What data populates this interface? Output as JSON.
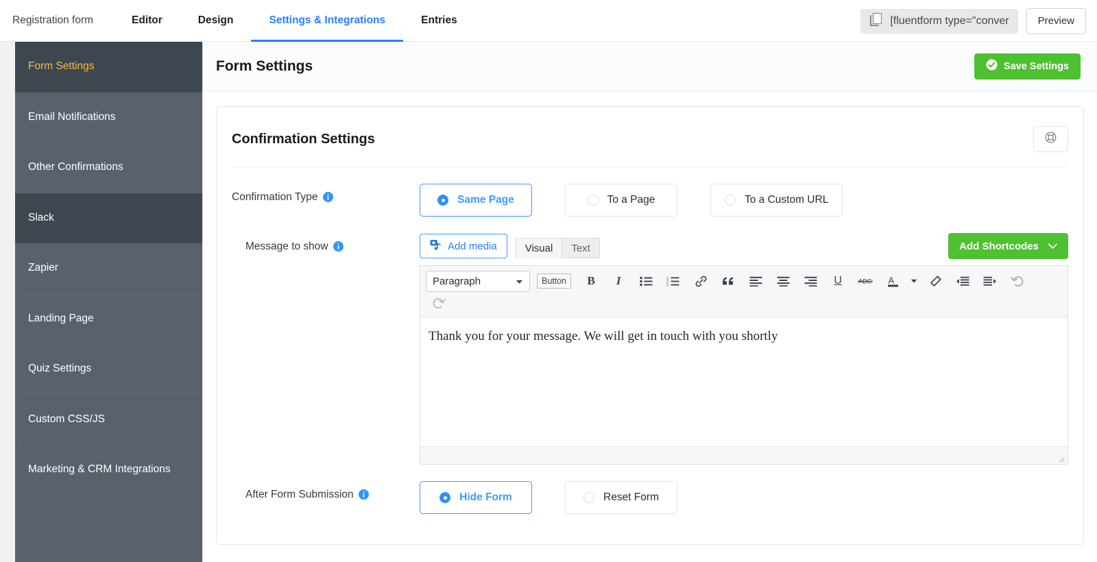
{
  "topbar": {
    "form_name": "Registration form",
    "tabs": [
      {
        "label": "Editor",
        "active": false
      },
      {
        "label": "Design",
        "active": false
      },
      {
        "label": "Settings & Integrations",
        "active": true
      },
      {
        "label": "Entries",
        "active": false
      }
    ],
    "shortcode": "[fluentform type=\"conver",
    "copy_icon": "copy-icon",
    "preview_label": "Preview"
  },
  "sidebar": {
    "items": [
      {
        "label": "Form Settings",
        "state": "active"
      },
      {
        "label": "Email Notifications",
        "state": "normal"
      },
      {
        "label": "Other Confirmations",
        "state": "normal"
      },
      {
        "label": "Slack",
        "state": "hover"
      },
      {
        "label": "Zapier",
        "state": "normal"
      },
      {
        "label": "Landing Page",
        "state": "normal"
      },
      {
        "label": "Quiz Settings",
        "state": "normal"
      },
      {
        "label": "Custom CSS/JS",
        "state": "normal"
      },
      {
        "label": "Marketing & CRM Integrations",
        "state": "normal"
      }
    ]
  },
  "main": {
    "title": "Form Settings",
    "save_label": "Save Settings",
    "save_icon": "check-circle-icon",
    "accent_green": "#4ec130",
    "accent_blue": "#2a7fff",
    "accent_yellow": "#f5bd3c"
  },
  "card": {
    "title": "Confirmation Settings",
    "help_icon": "lifebuoy-help-icon"
  },
  "confirmation_type": {
    "label": "Confirmation Type",
    "info_icon": "info-icon",
    "options": [
      {
        "label": "Same Page",
        "selected": true
      },
      {
        "label": "To a Page",
        "selected": false
      },
      {
        "label": "To a Custom URL",
        "selected": false
      }
    ]
  },
  "message": {
    "label": "Message to show",
    "info_icon": "info-icon",
    "add_media_label": "Add media",
    "add_media_icon": "media-icon",
    "editor_tabs": [
      {
        "label": "Visual",
        "active": true
      },
      {
        "label": "Text",
        "active": false
      }
    ],
    "shortcodes_label": "Add Shortcodes",
    "shortcodes_icon": "chevron-down-icon",
    "toolbar": {
      "format_select": "Paragraph",
      "format_caret_icon": "caret-down-icon",
      "button_chip": "Button",
      "items": [
        "bold-icon",
        "italic-icon",
        "bullet-list-icon",
        "numbered-list-icon",
        "link-icon",
        "blockquote-icon",
        "align-left-icon",
        "align-center-icon",
        "align-right-icon",
        "underline-icon",
        "strikethrough-icon",
        "text-color-icon",
        "text-color-caret-icon",
        "clear-formatting-icon",
        "outdent-icon",
        "indent-icon",
        "undo-icon"
      ],
      "second_row": [
        "redo-icon"
      ]
    },
    "content": "Thank you for your message. We will get in touch with you shortly"
  },
  "after_submission": {
    "label": "After Form Submission",
    "info_icon": "info-icon",
    "options": [
      {
        "label": "Hide Form",
        "selected": true
      },
      {
        "label": "Reset Form",
        "selected": false
      }
    ]
  }
}
